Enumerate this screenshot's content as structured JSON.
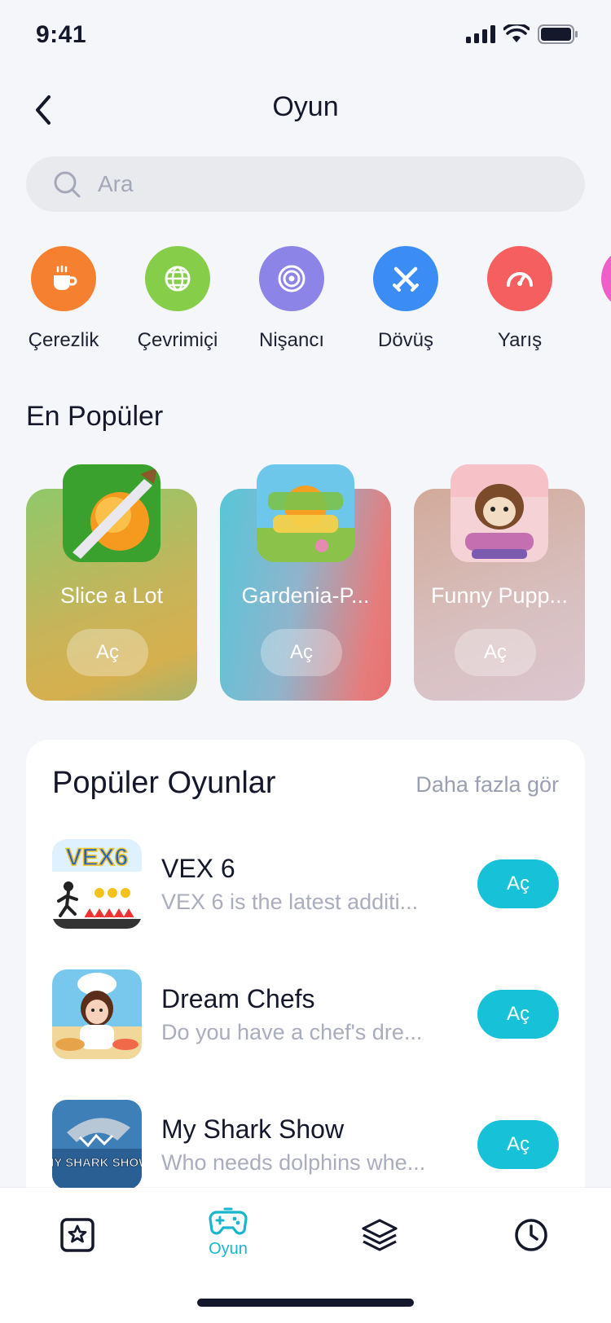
{
  "status_bar": {
    "time": "9:41"
  },
  "nav": {
    "title": "Oyun",
    "back_icon": "chevron-left-icon"
  },
  "search": {
    "placeholder": "Ara",
    "icon": "search-icon"
  },
  "categories": [
    {
      "label": "Çerezlik",
      "color": "#f5802f",
      "icon": "coffee-cup-icon"
    },
    {
      "label": "Çevrimiçi",
      "color": "#86cd4a",
      "icon": "globe-icon"
    },
    {
      "label": "Nişancı",
      "color": "#8d84e8",
      "icon": "target-icon"
    },
    {
      "label": "Dövüş",
      "color": "#3b8df5",
      "icon": "crossed-swords-icon"
    },
    {
      "label": "Yarış",
      "color": "#f65f5f",
      "icon": "speedometer-icon"
    },
    {
      "label": "",
      "color": "#ee5fc8",
      "icon": "category-icon"
    }
  ],
  "most_popular": {
    "title": "En Popüler",
    "items": [
      {
        "name": "Slice a Lot",
        "button": "Aç"
      },
      {
        "name": "Gardenia-P...",
        "button": "Aç"
      },
      {
        "name": "Funny Pupp...",
        "button": "Aç"
      }
    ]
  },
  "popular_games": {
    "title": "Popüler Oyunlar",
    "see_more": "Daha fazla gör",
    "items": [
      {
        "title": "VEX 6",
        "desc": "VEX 6 is the latest additi...",
        "button": "Aç",
        "icon_text": "VEX6"
      },
      {
        "title": "Dream Chefs",
        "desc": "Do you have a chef's dre...",
        "button": "Aç"
      },
      {
        "title": "My Shark Show",
        "desc": "Who needs dolphins whe...",
        "button": "Aç",
        "icon_text": "MY SHARK SHOW"
      }
    ]
  },
  "tab_bar": {
    "accent": "#17b6cc",
    "tabs": [
      {
        "label": "",
        "icon": "star-square-icon"
      },
      {
        "label": "Oyun",
        "icon": "gamepad-icon",
        "active": true
      },
      {
        "label": "",
        "icon": "layers-icon"
      },
      {
        "label": "",
        "icon": "clock-icon"
      }
    ]
  }
}
